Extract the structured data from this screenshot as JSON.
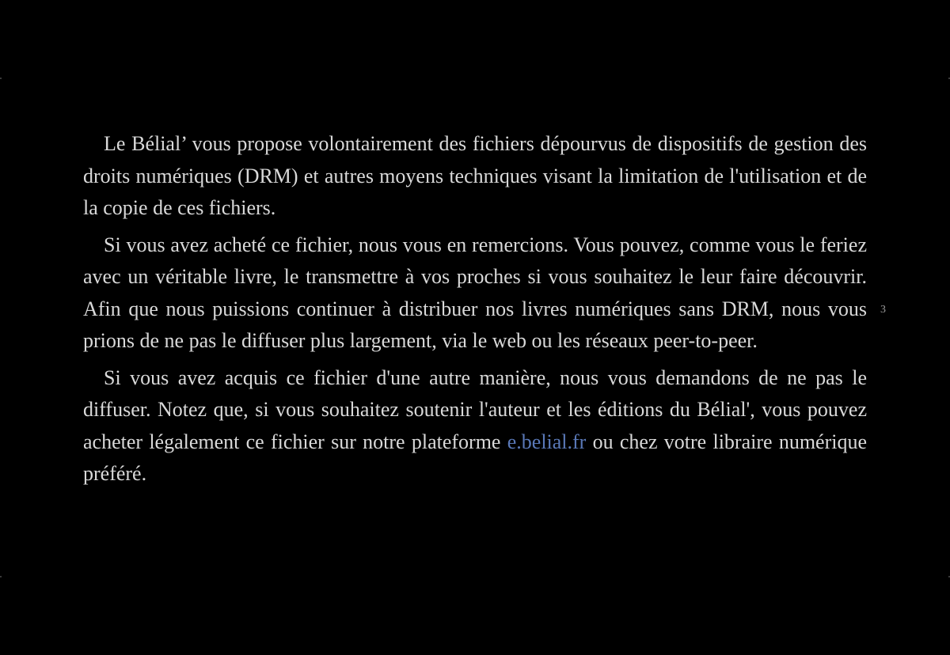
{
  "page": {
    "number": "3"
  },
  "paragraphs": {
    "p1": "Le Bélial’ vous propose volontairement des fichiers dépourvus de dispositifs de gestion des droits numériques (DRM) et autres moyens techniques visant la limi­tation de l'utilisation et de la copie de ces fichiers.",
    "p2": "Si vous avez acheté ce fichier, nous vous en remercions. Vous pouvez, comme vous le feriez avec un véritable livre, le transmettre à vos proches si vous souhai­tez le leur faire découvrir. Afin que nous puissions continuer à distribuer nos livres numériques sans DRM, nous vous prions de ne pas le diffuser plus large­ment, via le web ou les réseaux peer-to-peer.",
    "p3_before_link": "Si vous avez acquis ce fichier d'une autre manière, nous vous demandons de ne pas le diffuser. Notez que, si vous souhaitez soutenir l'auteur et les éditions du Bélial', vous pouvez acheter légalement ce fichier sur notre plateforme ",
    "p3_link": "e.belial.fr",
    "p3_after_link": " ou chez votre libraire numérique préféré."
  },
  "colors": {
    "background": "#000000",
    "text": "#d9d9d9",
    "link": "#5a79b8"
  }
}
